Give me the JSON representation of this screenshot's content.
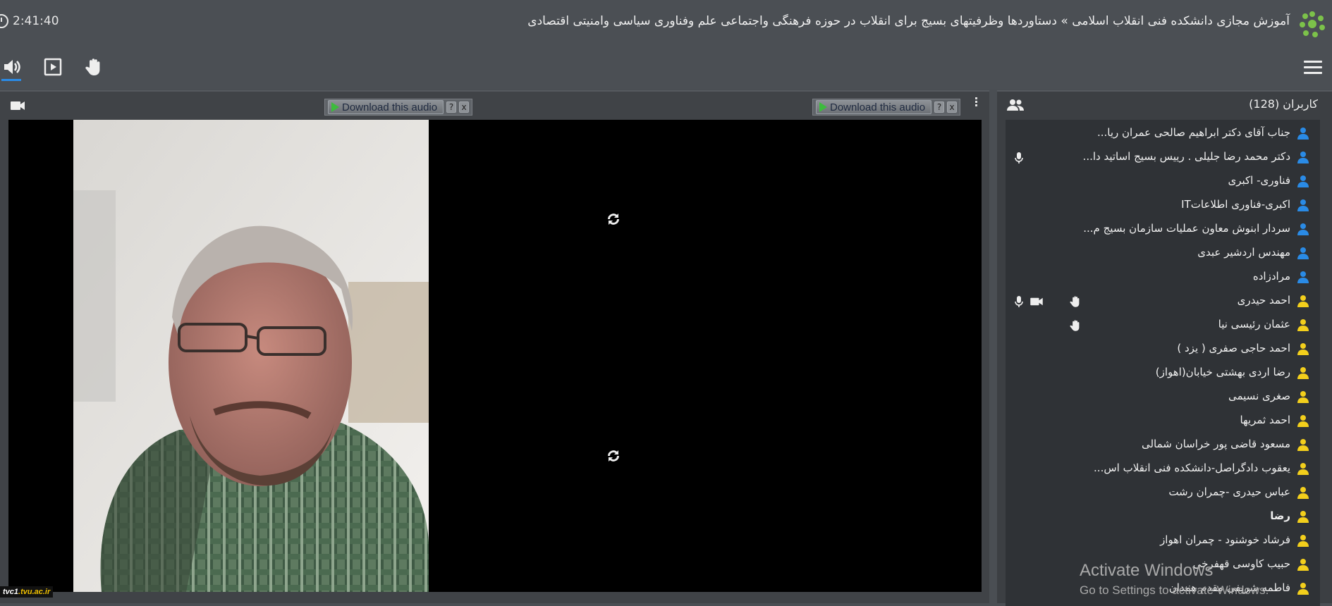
{
  "header": {
    "time": "2:41:40",
    "title": "آموزش مجازی دانشکده فنی انقلاب اسلامی » دستاوردها وظرفیتهای بسیج برای انقلاب در حوزه فرهنگی واجتماعی علم وفناوری سیاسی وامنیتی اقتصادی"
  },
  "toolbar": {
    "icons": [
      "speaker-icon",
      "screen-share-icon",
      "raise-hand-icon",
      "hamburger-menu-icon"
    ]
  },
  "video": {
    "download_label_1": "Download this audio",
    "download_label_2": "Download this audio",
    "help": "?",
    "close": "x",
    "watermark": "tvc1",
    "watermark_domain": ".tvu.ac.ir"
  },
  "users": {
    "title": "کاربران (128)",
    "moderator_color": "#2a8be6",
    "viewer_color": "#f3cf1c",
    "list": [
      {
        "name": "جناب آقای دکتر ابراهیم صالحی عمران ریا...",
        "role": "moderator"
      },
      {
        "name": "دکتر محمد رضا جلیلی . رییس بسیج اساتید دا...",
        "role": "moderator",
        "mic": true
      },
      {
        "name": "فناوری- اکبری",
        "role": "moderator"
      },
      {
        "name": "اکبری-فناوری اطلاعاتIT",
        "role": "moderator"
      },
      {
        "name": "سردار ابنوش معاون عملیات سازمان بسیج م...",
        "role": "moderator"
      },
      {
        "name": "مهندس اردشیر عبدی",
        "role": "moderator"
      },
      {
        "name": "مرادزاده",
        "role": "moderator"
      },
      {
        "name": "احمد حیدری",
        "role": "viewer",
        "mic": true,
        "cam": true,
        "hand": true
      },
      {
        "name": "عثمان رئیسی نیا",
        "role": "viewer",
        "hand": true
      },
      {
        "name": "احمد حاجی صفری ( یزد )",
        "role": "viewer"
      },
      {
        "name": "رضا اردی بهشتی خیابان(اهواز)",
        "role": "viewer"
      },
      {
        "name": "صغری نسیمی",
        "role": "viewer"
      },
      {
        "name": "احمد ثمریها",
        "role": "viewer"
      },
      {
        "name": "مسعود قاضی پور خراسان شمالی",
        "role": "viewer"
      },
      {
        "name": "یعقوب دادگراصل-دانشکده فنی انقلاب اس...",
        "role": "viewer"
      },
      {
        "name": "عباس حیدری -چمران رشت",
        "role": "viewer"
      },
      {
        "name": "رضا",
        "role": "viewer",
        "bold": true
      },
      {
        "name": "فرشاد خوشنود - چمران اهواز",
        "role": "viewer"
      },
      {
        "name": "حبیب کاوسی قهفرخی",
        "role": "viewer"
      },
      {
        "name": "فاطمه شریفی مقدم همدان",
        "role": "viewer"
      }
    ]
  },
  "os_overlay": {
    "line1": "Activate Windows",
    "line2": "Go to Settings to activate Windows."
  }
}
